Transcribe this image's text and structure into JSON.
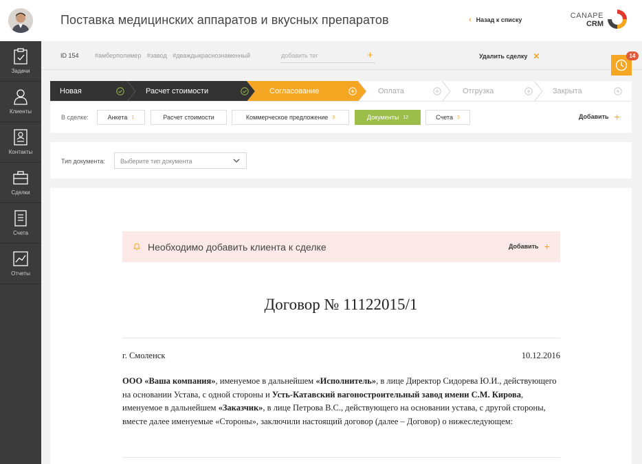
{
  "app": {
    "title": "Поставка медицинских аппаратов и вкусных препаратов",
    "back_label": "Назад к списку",
    "logo_line1": "CANAPE",
    "logo_line2": "CRM"
  },
  "sidebar": {
    "items": [
      {
        "label": "Задачи",
        "icon": "clipboard-check-icon"
      },
      {
        "label": "Клиенты",
        "icon": "person-icon"
      },
      {
        "label": "Контакты",
        "icon": "contact-card-icon"
      },
      {
        "label": "Сделки",
        "icon": "briefcase-icon"
      },
      {
        "label": "Счета",
        "icon": "invoice-icon"
      },
      {
        "label": "Отчеты",
        "icon": "chart-icon"
      }
    ]
  },
  "deal": {
    "id": "ID 154",
    "tags": [
      "#амберполимер",
      "#завод",
      "#дваждыкраснознаменный"
    ],
    "tag_placeholder": "добавить тег",
    "delete_label": "Удалить сделку",
    "timer_count": "14"
  },
  "pipeline": {
    "stages": [
      {
        "label": "Новая",
        "state": "done"
      },
      {
        "label": "Расчет стоимости",
        "state": "done"
      },
      {
        "label": "Согласование",
        "state": "current"
      },
      {
        "label": "Оплата",
        "state": "pending"
      },
      {
        "label": "Отгрузка",
        "state": "pending"
      },
      {
        "label": "Закрыта",
        "state": "pending"
      }
    ]
  },
  "tabs": {
    "label": "В сделке:",
    "items": [
      {
        "label": "Анкета",
        "count": "1"
      },
      {
        "label": "Расчет стоимости",
        "count": ""
      },
      {
        "label": "Коммерческое предложение",
        "count": "3"
      },
      {
        "label": "Документы",
        "count": "12"
      },
      {
        "label": "Счета",
        "count": "5"
      }
    ],
    "add_label": "Добавить"
  },
  "doc_filter": {
    "label": "Тип документа:",
    "placeholder": "Выберите тип документа"
  },
  "alert": {
    "text": "Необходимо добавить клиента к сделке",
    "action": "Добавить"
  },
  "document": {
    "title": "Договор № 11122015/1",
    "city": "г. Смоленск",
    "date": "10.12.2016",
    "p1": "ООО «Ваша компания»",
    "p2": ", именуемое в дальнейшем ",
    "p3": "«Исполнитель»",
    "p4": ", в лице Директор Сидорева Ю.И., действующего на основании Устава, с одной стороны и ",
    "p5": "Усть-Катавский вагоностроительный завод имени С.М. Кирова",
    "p6": ", именуемое в дальнейшем ",
    "p7": "«Заказчик»",
    "p8": ", в лице Петрова В.С., действующего на основании устава, с другой стороны, вместе далее именуемые «Стороны», заключили настоящий договор (далее – Договор) о нижеследующем:"
  },
  "colors": {
    "accent": "#f5a623",
    "sidebar": "#3b3b3b",
    "stage_done": "#333333",
    "tab_active": "#9cbd4a",
    "alert_bg": "#fae9e6"
  }
}
